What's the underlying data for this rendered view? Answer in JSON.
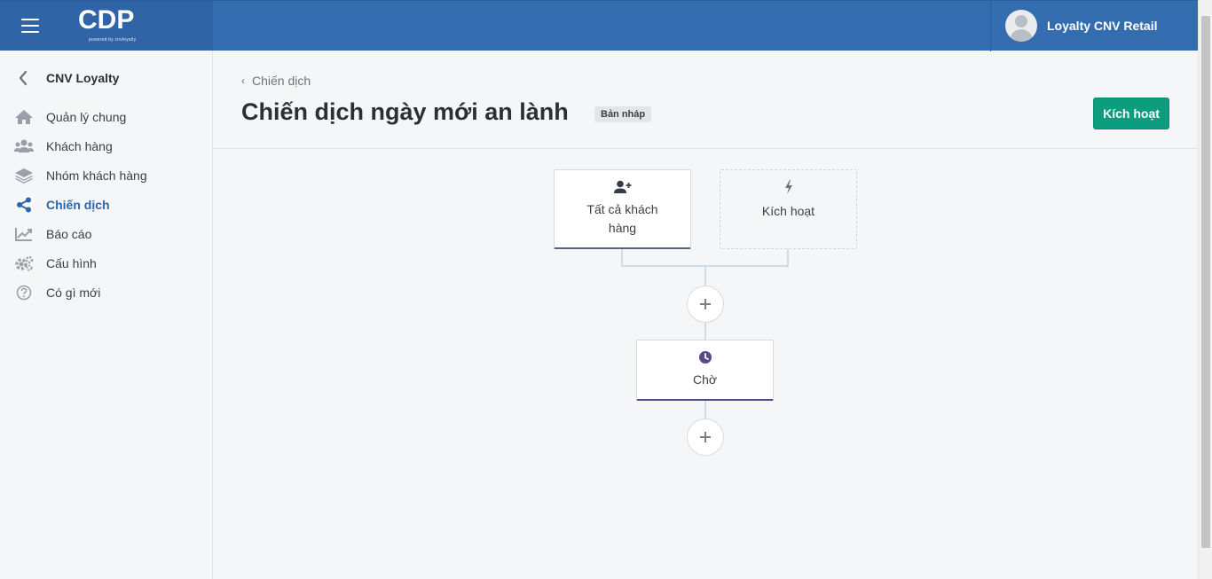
{
  "header": {
    "logo_text": "CDP",
    "logo_subtext": "powered by cnvloyalty",
    "user_name": "Loyalty CNV Retail"
  },
  "sidebar": {
    "title": "CNV Loyalty",
    "items": [
      {
        "label": "Quản lý chung",
        "icon": "home-icon"
      },
      {
        "label": "Khách hàng",
        "icon": "users-icon"
      },
      {
        "label": "Nhóm khách hàng",
        "icon": "layers-icon"
      },
      {
        "label": "Chiến dịch",
        "icon": "share-icon",
        "active": true
      },
      {
        "label": "Báo cáo",
        "icon": "chart-line-icon"
      },
      {
        "label": "Cấu hình",
        "icon": "cogs-icon"
      },
      {
        "label": "Có gì mới",
        "icon": "question-circle-icon"
      }
    ]
  },
  "main": {
    "breadcrumb": "Chiến dịch",
    "title": "Chiến dịch ngày mới an lành",
    "status_badge": "Bản nháp",
    "activate_button": "Kích hoạt"
  },
  "flow": {
    "audience_node": {
      "label": "Tất cả khách hàng",
      "icon": "user-plus-icon"
    },
    "trigger_node": {
      "label": "Kích hoạt",
      "icon": "bolt-icon"
    },
    "wait_node": {
      "label": "Chờ",
      "icon": "clock-icon"
    },
    "add_step_icon": "plus-icon"
  },
  "colors": {
    "header_bg": "#336db0",
    "brand_bg": "#2f65a6",
    "accent": "#2d66ad",
    "activate_button": "#0b9d7d",
    "wait_node_border": "#5b4a8a"
  }
}
